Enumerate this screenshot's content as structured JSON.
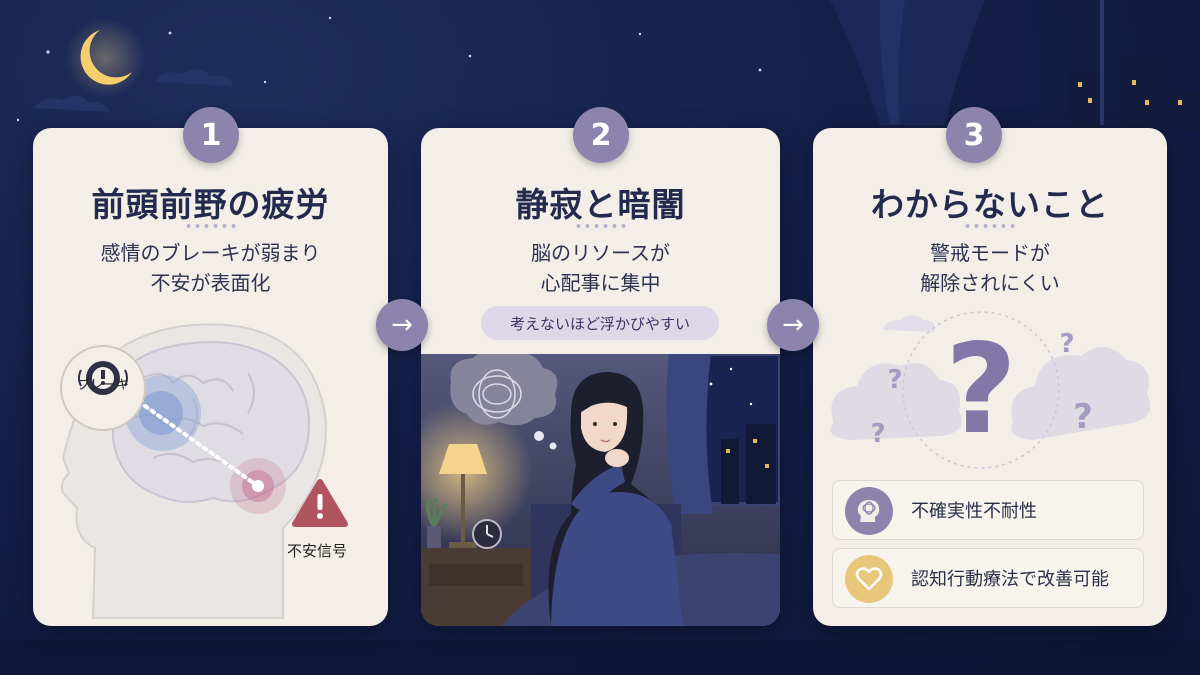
{
  "steps": [
    {
      "number": "1",
      "title": "前頭前野の疲労",
      "subtitle_line1": "感情のブレーキが弱まり",
      "subtitle_line2": "不安が表面化",
      "brake_label": "ブレーキ",
      "anxiety_label": "不安信号"
    },
    {
      "number": "2",
      "title": "静寂と暗闇",
      "subtitle_line1": "脳のリソースが",
      "subtitle_line2": "心配事に集中",
      "pill": "考えないほど浮かびやすい"
    },
    {
      "number": "3",
      "title": "わからないこと",
      "subtitle_line1": "警戒モードが",
      "subtitle_line2": "解除されにくい",
      "items": [
        {
          "label": "不確実性不耐性",
          "icon": "head-tangle-icon"
        },
        {
          "label": "認知行動療法で改善可能",
          "icon": "heart-icon"
        }
      ]
    }
  ],
  "arrow_symbol": "→",
  "colors": {
    "background": "#15204a",
    "card": "#f3efe8",
    "accent": "#8d84ad",
    "title": "#232a4d",
    "warning": "#b0545f",
    "heart_bg": "#e7c77b"
  }
}
